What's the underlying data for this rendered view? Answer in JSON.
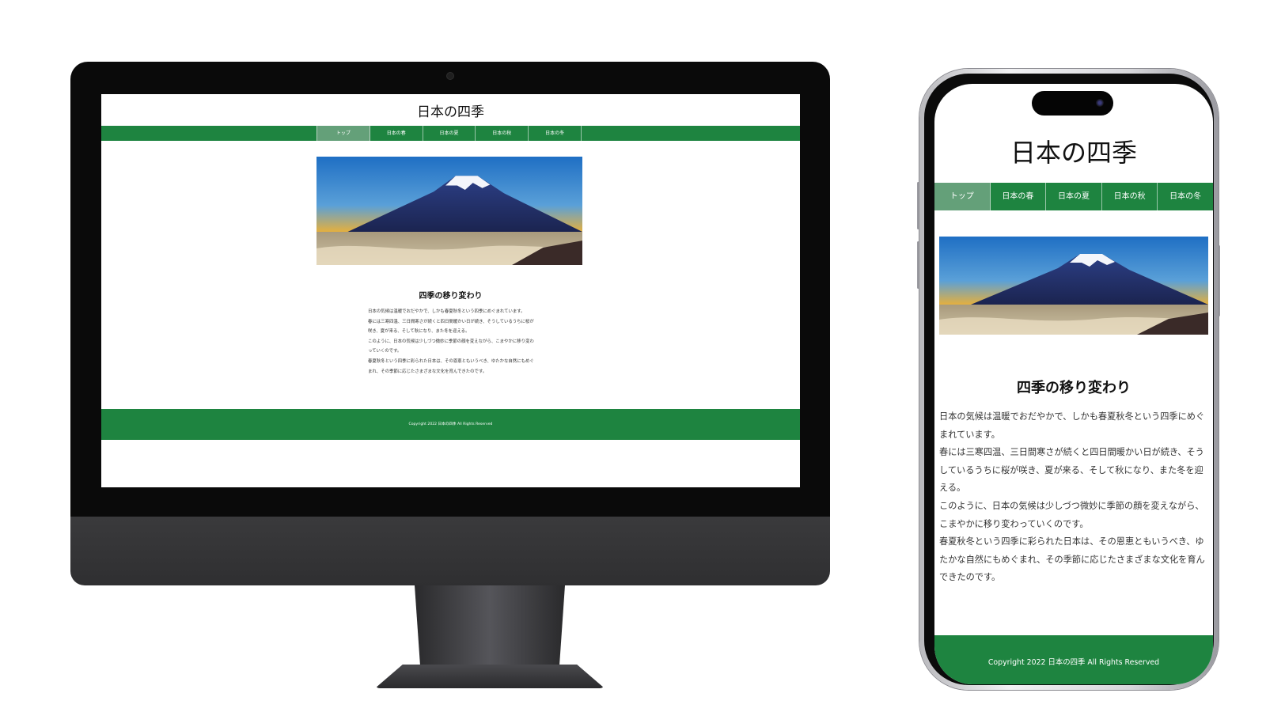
{
  "site": {
    "title": "日本の四季",
    "nav": [
      "トップ",
      "日本の春",
      "日本の夏",
      "日本の秋",
      "日本の冬"
    ],
    "active_nav": "トップ",
    "heading": "四季の移り変わり",
    "paragraphs": [
      "日本の気候は温暖でおだやかで、しかも春夏秋冬という四季にめぐまれています。",
      "春には三寒四温、三日間寒さが続くと四日間暖かい日が続き、そうしているうちに桜が咲き、夏が来る、そして秋になり、また冬を迎える。",
      "このように、日本の気候は少しづつ微妙に季節の顔を変えながら、こまやかに移り変わっていくのです。",
      "春夏秋冬という四季に彩られた日本は、その恩恵ともいうべき、ゆたかな自然にもめぐまれ、その季節に応じたさまざまな文化を育んできたのです。"
    ],
    "footer": "Copyright 2022 日本の四季 All Rights Reserved",
    "hero_icon": "mount-fuji-photo"
  },
  "colors": {
    "nav_green": "#1e8440",
    "nav_active": "#64a079",
    "device_dark": "#0a0a0a"
  }
}
